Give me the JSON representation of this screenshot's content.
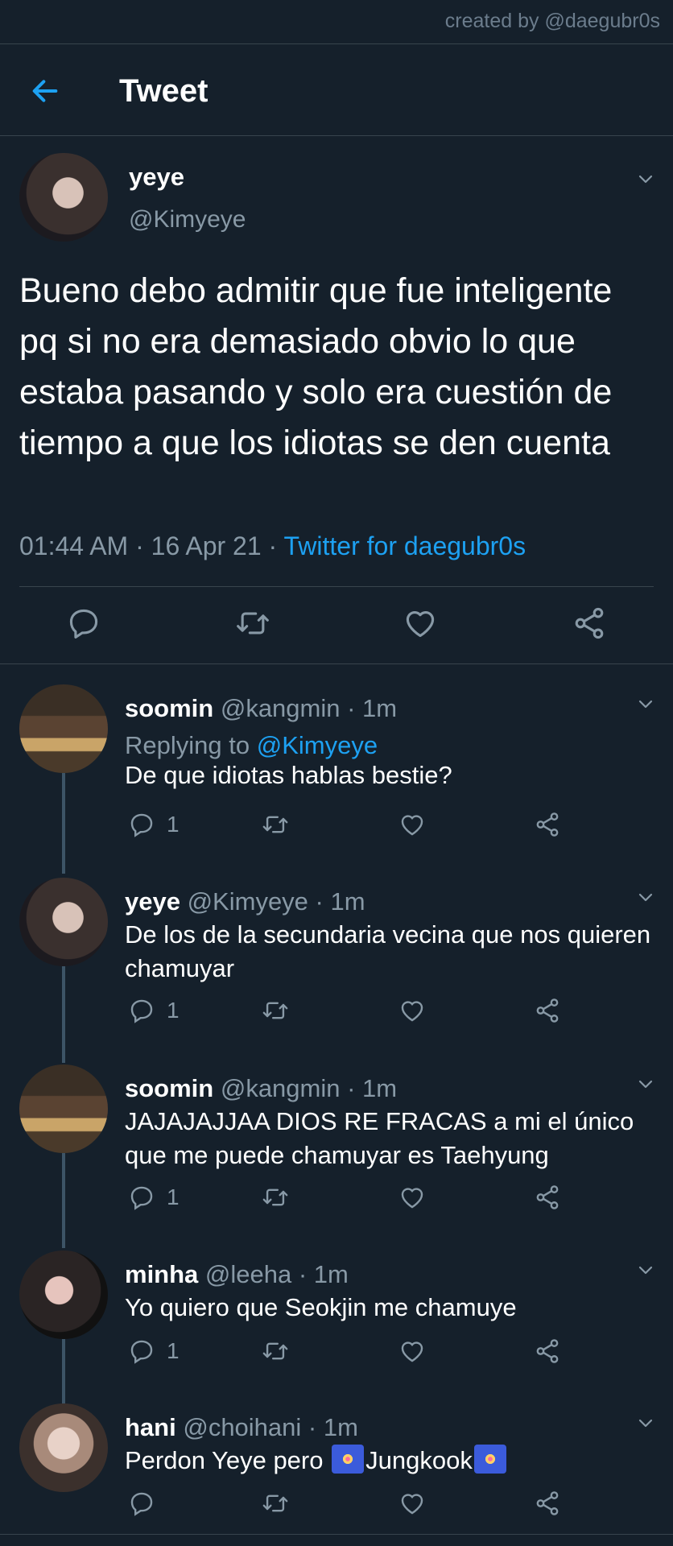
{
  "credit": "created by @daegubr0s",
  "topbar": {
    "title": "Tweet"
  },
  "main_tweet": {
    "name": "yeye",
    "handle": "@Kimyeye",
    "text": "Bueno debo admitir que fue inteligente pq si no era demasiado obvio lo que estaba pasando y solo era cuestión de tiempo a que los idiotas se den cuenta",
    "time": "01:44 AM · 16 Apr 21 · ",
    "source": "Twitter for daegubr0s"
  },
  "replies": [
    {
      "name": "soomin",
      "meta": " @kangmin · 1m",
      "replying_prefix": "Replying to ",
      "replying_handle": "@Kimyeye",
      "text": "De que idiotas hablas bestie?",
      "reply_count": "1"
    },
    {
      "name": "yeye",
      "meta": " @Kimyeye · 1m",
      "text": "De los de la secundaria vecina que nos quieren chamuyar",
      "reply_count": "1"
    },
    {
      "name": "soomin",
      "meta": " @kangmin · 1m",
      "text": "JAJAJAJJAA DIOS RE FRACAS a mi el único que me puede chamuyar es Taehyung",
      "reply_count": "1"
    },
    {
      "name": "minha",
      "meta": " @leeha · 1m",
      "text": "Yo quiero que Seokjin me chamuye",
      "reply_count": "1"
    },
    {
      "name": "hani",
      "meta": " @choihani · 1m",
      "text_before": "Perdon Yeye pero ",
      "text_middle": "Jungkook",
      "reply_count": ""
    }
  ],
  "colors": {
    "background": "#15202b",
    "accent": "#1da1f2",
    "muted": "#8899a6",
    "divider": "#38444d"
  }
}
